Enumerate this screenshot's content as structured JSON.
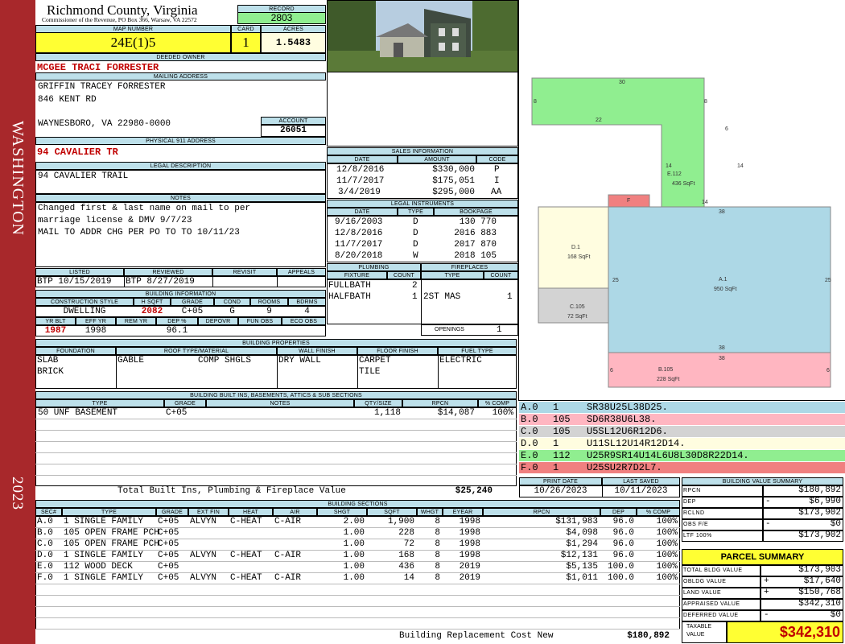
{
  "sidebar": {
    "county": "WASHINGTON",
    "year": "2023"
  },
  "header": {
    "title": "Richmond County, Virginia",
    "subtitle": "Commissioner of the Revenue, PO Box 366, Warsaw, VA 22572",
    "record_label": "RECORD",
    "record": "2803",
    "map_label": "MAP NUMBER",
    "map": "24E(1)5",
    "card_label": "CARD",
    "card": "1",
    "acres_label": "ACRES",
    "acres": "1.5483"
  },
  "owner": {
    "label": "DEEDED OWNER",
    "name": "MCGEE TRACI FORRESTER"
  },
  "mailing": {
    "label": "MAILING ADDRESS",
    "line1": "GRIFFIN TRACEY FORRESTER",
    "line2": "846 KENT RD",
    "line3": "WAYNESBORO, VA 22980-0000",
    "account_label": "ACCOUNT",
    "account": "26051"
  },
  "physical": {
    "label": "PHYSICAL 911 ADDRESS",
    "value": "94 CAVALIER TR"
  },
  "legal": {
    "label": "LEGAL DESCRIPTION",
    "value": "94 CAVALIER TRAIL"
  },
  "notes": {
    "label": "NOTES",
    "line1": "Changed first & last name on mail to per",
    "line2": "marriage license & DMV 9/7/23",
    "line3": "MAIL TO ADDR CHG PER PO TO TO 10/11/23"
  },
  "listed": {
    "listed_label": "LISTED",
    "listed": "BTP  10/15/2019",
    "reviewed_label": "REVIEWED",
    "reviewed": "BTP   8/27/2019",
    "revisit_label": "REVISIT",
    "appeals_label": "APPEALS"
  },
  "building": {
    "label": "BUILDING INFORMATION",
    "h": [
      "CONSTRUCTION STYLE",
      "H SQFT",
      "GRADE",
      "COND",
      "ROOMS",
      "BDRMS"
    ],
    "v": [
      "DWELLING",
      "2082",
      "C+05",
      "G",
      "9",
      "4"
    ],
    "h2": [
      "YR BLT",
      "EFF YR",
      "REM YR",
      "DEP %",
      "DEPOVR",
      "FUN OBS",
      "ECO OBS"
    ],
    "v2": [
      "1987",
      "1998",
      "",
      "96.1",
      "",
      "",
      ""
    ]
  },
  "sales": {
    "label": "SALES INFORMATION",
    "h": [
      "DATE",
      "AMOUNT",
      "CODE"
    ],
    "rows": [
      [
        "12/8/2016",
        "$330,000",
        "P"
      ],
      [
        "11/7/2017",
        "$175,051",
        "I"
      ],
      [
        "3/4/2019",
        "$295,000",
        "AA"
      ]
    ]
  },
  "instruments": {
    "label": "LEGAL INSTRUMENTS",
    "h": [
      "DATE",
      "TYPE",
      "BOOKPAGE"
    ],
    "rows": [
      [
        "9/16/2003",
        "D",
        "130 770"
      ],
      [
        "12/8/2016",
        "D",
        "2016 883"
      ],
      [
        "11/7/2017",
        "D",
        "2017 870"
      ],
      [
        "8/20/2018",
        "W",
        "2018 105"
      ]
    ]
  },
  "plumbing": {
    "label": "PLUMBING",
    "h": [
      "FIXTURE",
      "COUNT"
    ],
    "rows": [
      [
        "FULLBATH",
        "2"
      ],
      [
        "HALFBATH",
        "1"
      ]
    ]
  },
  "fireplaces": {
    "label": "FIREPLACES",
    "h": [
      "TYPE",
      "COUNT"
    ],
    "rows": [
      [
        "2ST MAS",
        "1"
      ]
    ],
    "openings_label": "OPENINGS",
    "openings": "1"
  },
  "props": {
    "label": "BUILDING PROPERTIES",
    "h": [
      "FOUNDATION",
      "ROOF TYPE/MATERIAL",
      "WALL FINISH",
      "FLOOR FINISH",
      "FUEL TYPE"
    ],
    "foundation": [
      "SLAB",
      "BRICK"
    ],
    "roof_type": "GABLE",
    "roof_mat": "COMP SHGLS",
    "wall": "DRY WALL",
    "floor": [
      "CARPET",
      "TILE"
    ],
    "fuel": "ELECTRIC"
  },
  "builtins": {
    "label": "BUILDING BUILT INS, BASEMENTS, ATTICS & SUB SECTIONS",
    "h": [
      "TYPE",
      "GRADE",
      "NOTES",
      "QTY/SIZE",
      "RPCN",
      "% COMP"
    ],
    "rows": [
      [
        "50 UNF BASEMENT",
        "C+05",
        "",
        "1,118",
        "$14,087",
        "100%"
      ]
    ],
    "total_label": "Total Built Ins, Plumbing & Fireplace Value",
    "total": "$25,240"
  },
  "print": {
    "print_label": "PRINT DATE",
    "print": "10/26/2023",
    "saved_label": "LAST SAVED",
    "saved": "10/11/2023"
  },
  "sections": {
    "label": "BUILDING SECTIONS",
    "h": [
      "SEC#",
      "TYPE",
      "GRADE",
      "EXT FIN",
      "HEAT",
      "AIR",
      "SHGT",
      "SQFT",
      "WHGT",
      "EYEAR",
      "RPCN",
      "DEP",
      "% COMP"
    ],
    "rows": [
      [
        "A.0",
        "1 SINGLE FAMILY",
        "C+05",
        "ALVYN",
        "C-HEAT",
        "C-AIR",
        "2.00",
        "1,900",
        "8",
        "1998",
        "$131,983",
        "96.0",
        "100%"
      ],
      [
        "B.0",
        "105 OPEN FRAME PCH",
        "C+05",
        "",
        "",
        "",
        "1.00",
        "228",
        "8",
        "1998",
        "$4,098",
        "96.0",
        "100%"
      ],
      [
        "C.0",
        "105 OPEN FRAME PCH",
        "C+05",
        "",
        "",
        "",
        "1.00",
        "72",
        "8",
        "1998",
        "$1,294",
        "96.0",
        "100%"
      ],
      [
        "D.0",
        "1 SINGLE FAMILY",
        "C+05",
        "ALVYN",
        "C-HEAT",
        "C-AIR",
        "1.00",
        "168",
        "8",
        "1998",
        "$12,131",
        "96.0",
        "100%"
      ],
      [
        "E.0",
        "112 WOOD DECK",
        "C+05",
        "",
        "",
        "",
        "1.00",
        "436",
        "8",
        "2019",
        "$5,135",
        "100.0",
        "100%"
      ],
      [
        "F.0",
        "1 SINGLE FAMILY",
        "C+05",
        "ALVYN",
        "C-HEAT",
        "C-AIR",
        "1.00",
        "14",
        "8",
        "2019",
        "$1,011",
        "100.0",
        "100%"
      ]
    ],
    "total_label": "Building Replacement Cost New",
    "total": "$180,892"
  },
  "sketch": {
    "labels": [
      {
        "t": "30"
      },
      {
        "t": "8"
      },
      {
        "t": "8"
      },
      {
        "t": "22"
      },
      {
        "t": "6"
      },
      {
        "t": "14"
      },
      {
        "t": "14"
      },
      {
        "t": "14"
      },
      {
        "t": "E.112"
      },
      {
        "t": "436 SqFt"
      },
      {
        "t": "F"
      },
      {
        "t": "38"
      },
      {
        "t": "D.1"
      },
      {
        "t": "168 SqFt"
      },
      {
        "t": "25"
      },
      {
        "t": "25"
      },
      {
        "t": "A.1"
      },
      {
        "t": "950 SqFt"
      },
      {
        "t": "C.105"
      },
      {
        "t": "72 SqFt"
      },
      {
        "t": "38"
      },
      {
        "t": "38"
      },
      {
        "t": "6"
      },
      {
        "t": "6"
      },
      {
        "t": "B.105"
      },
      {
        "t": "228 SqFt"
      }
    ],
    "colors": {
      "green": "#90ee90",
      "blue": "#add8e6",
      "pink": "#ffb6c1",
      "cream": "#fffde0",
      "gray": "#d3d3d3",
      "red": "#f08080"
    }
  },
  "codes": [
    {
      "sec": "A.0",
      "n": "1",
      "code": "SR38U25L38D25.",
      "bg": "#add8e6"
    },
    {
      "sec": "B.0",
      "n": "105",
      "code": "SD6R38U6L38.",
      "bg": "#ffb6c1"
    },
    {
      "sec": "C.0",
      "n": "105",
      "code": "U5SL12U6R12D6.",
      "bg": "#d3d3d3"
    },
    {
      "sec": "D.0",
      "n": "1",
      "code": "U11SL12U14R12D14.",
      "bg": "#fffde0"
    },
    {
      "sec": "E.0",
      "n": "112",
      "code": "U25R9SR14U14L6U8L30D8R22D14.",
      "bg": "#90ee90"
    },
    {
      "sec": "F.0",
      "n": "1",
      "code": "U25SU2R7D2L7.",
      "bg": "#f08080"
    }
  ],
  "value_summary": {
    "label": "BUILDING VALUE SUMMARY",
    "rows": [
      [
        "RPCN",
        "",
        "$180,892"
      ],
      [
        "DEP",
        "-",
        "$6,990"
      ],
      [
        "RCLND",
        "",
        "$173,902"
      ],
      [
        "OBS F/E",
        "-",
        "$0"
      ],
      [
        "LTF    100%",
        "",
        "$173,902"
      ]
    ]
  },
  "parcel": {
    "label": "PARCEL SUMMARY",
    "rows": [
      [
        "TOTAL BLDG VALUE",
        "",
        "$173,903"
      ],
      [
        "OBLDG VALUE",
        "+",
        "$17,640"
      ],
      [
        "LAND VALUE",
        "+",
        "$150,768"
      ],
      [
        "APPRAISED VALUE",
        "",
        "$342,310"
      ],
      [
        "DEFERRED VALUE",
        "-",
        "$0"
      ]
    ],
    "taxable_label1": "TAXABLE",
    "taxable_label2": "VALUE",
    "taxable": "$342,310",
    "yellow": "#ffff33"
  }
}
